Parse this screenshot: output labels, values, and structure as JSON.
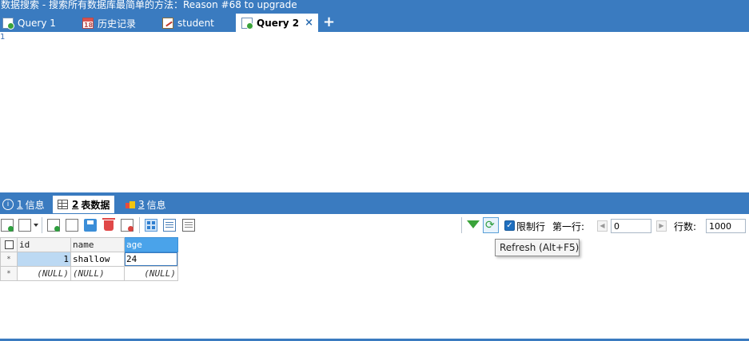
{
  "window": {
    "title": "数据搜索 - 搜索所有数据库最简单的方法：Reason #68 to upgrade"
  },
  "tabs": [
    {
      "label": "Query 1",
      "icon": "query-icon",
      "active": false
    },
    {
      "label": "历史记录",
      "icon": "calendar-icon",
      "calendar_day": "18",
      "active": false
    },
    {
      "label": "student",
      "icon": "table-edit-icon",
      "active": false
    },
    {
      "label": "Query 2",
      "icon": "query-icon",
      "active": true
    }
  ],
  "tab_close": "×",
  "tab_add": "+",
  "editor": {
    "line_numbers": [
      "1"
    ]
  },
  "result_tabs": [
    {
      "num": "1",
      "label": "信息",
      "icon": "info-icon"
    },
    {
      "num": "2",
      "label": "表数据",
      "icon": "grid-icon",
      "active": true
    },
    {
      "num": "3",
      "label": "信息",
      "icon": "box-icon"
    }
  ],
  "toolbar": {
    "limit_label": "限制行",
    "limit_checked": true,
    "first_row_label": "第一行:",
    "first_row_value": "0",
    "rows_label": "行数:",
    "rows_value": "1000",
    "refresh_tooltip": "Refresh (Alt+F5)"
  },
  "grid": {
    "columns": [
      "id",
      "name",
      "age"
    ],
    "selected_column": "age",
    "rows": [
      {
        "marker": "*",
        "id": "1",
        "name": "shallow",
        "age": "24"
      },
      {
        "marker": "*",
        "id": "(NULL)",
        "name": "(NULL)",
        "age": "(NULL)"
      }
    ]
  },
  "colors": {
    "accent": "#3a7bc0",
    "selection": "#bcd9f3",
    "header_selected": "#4aa3ea"
  }
}
